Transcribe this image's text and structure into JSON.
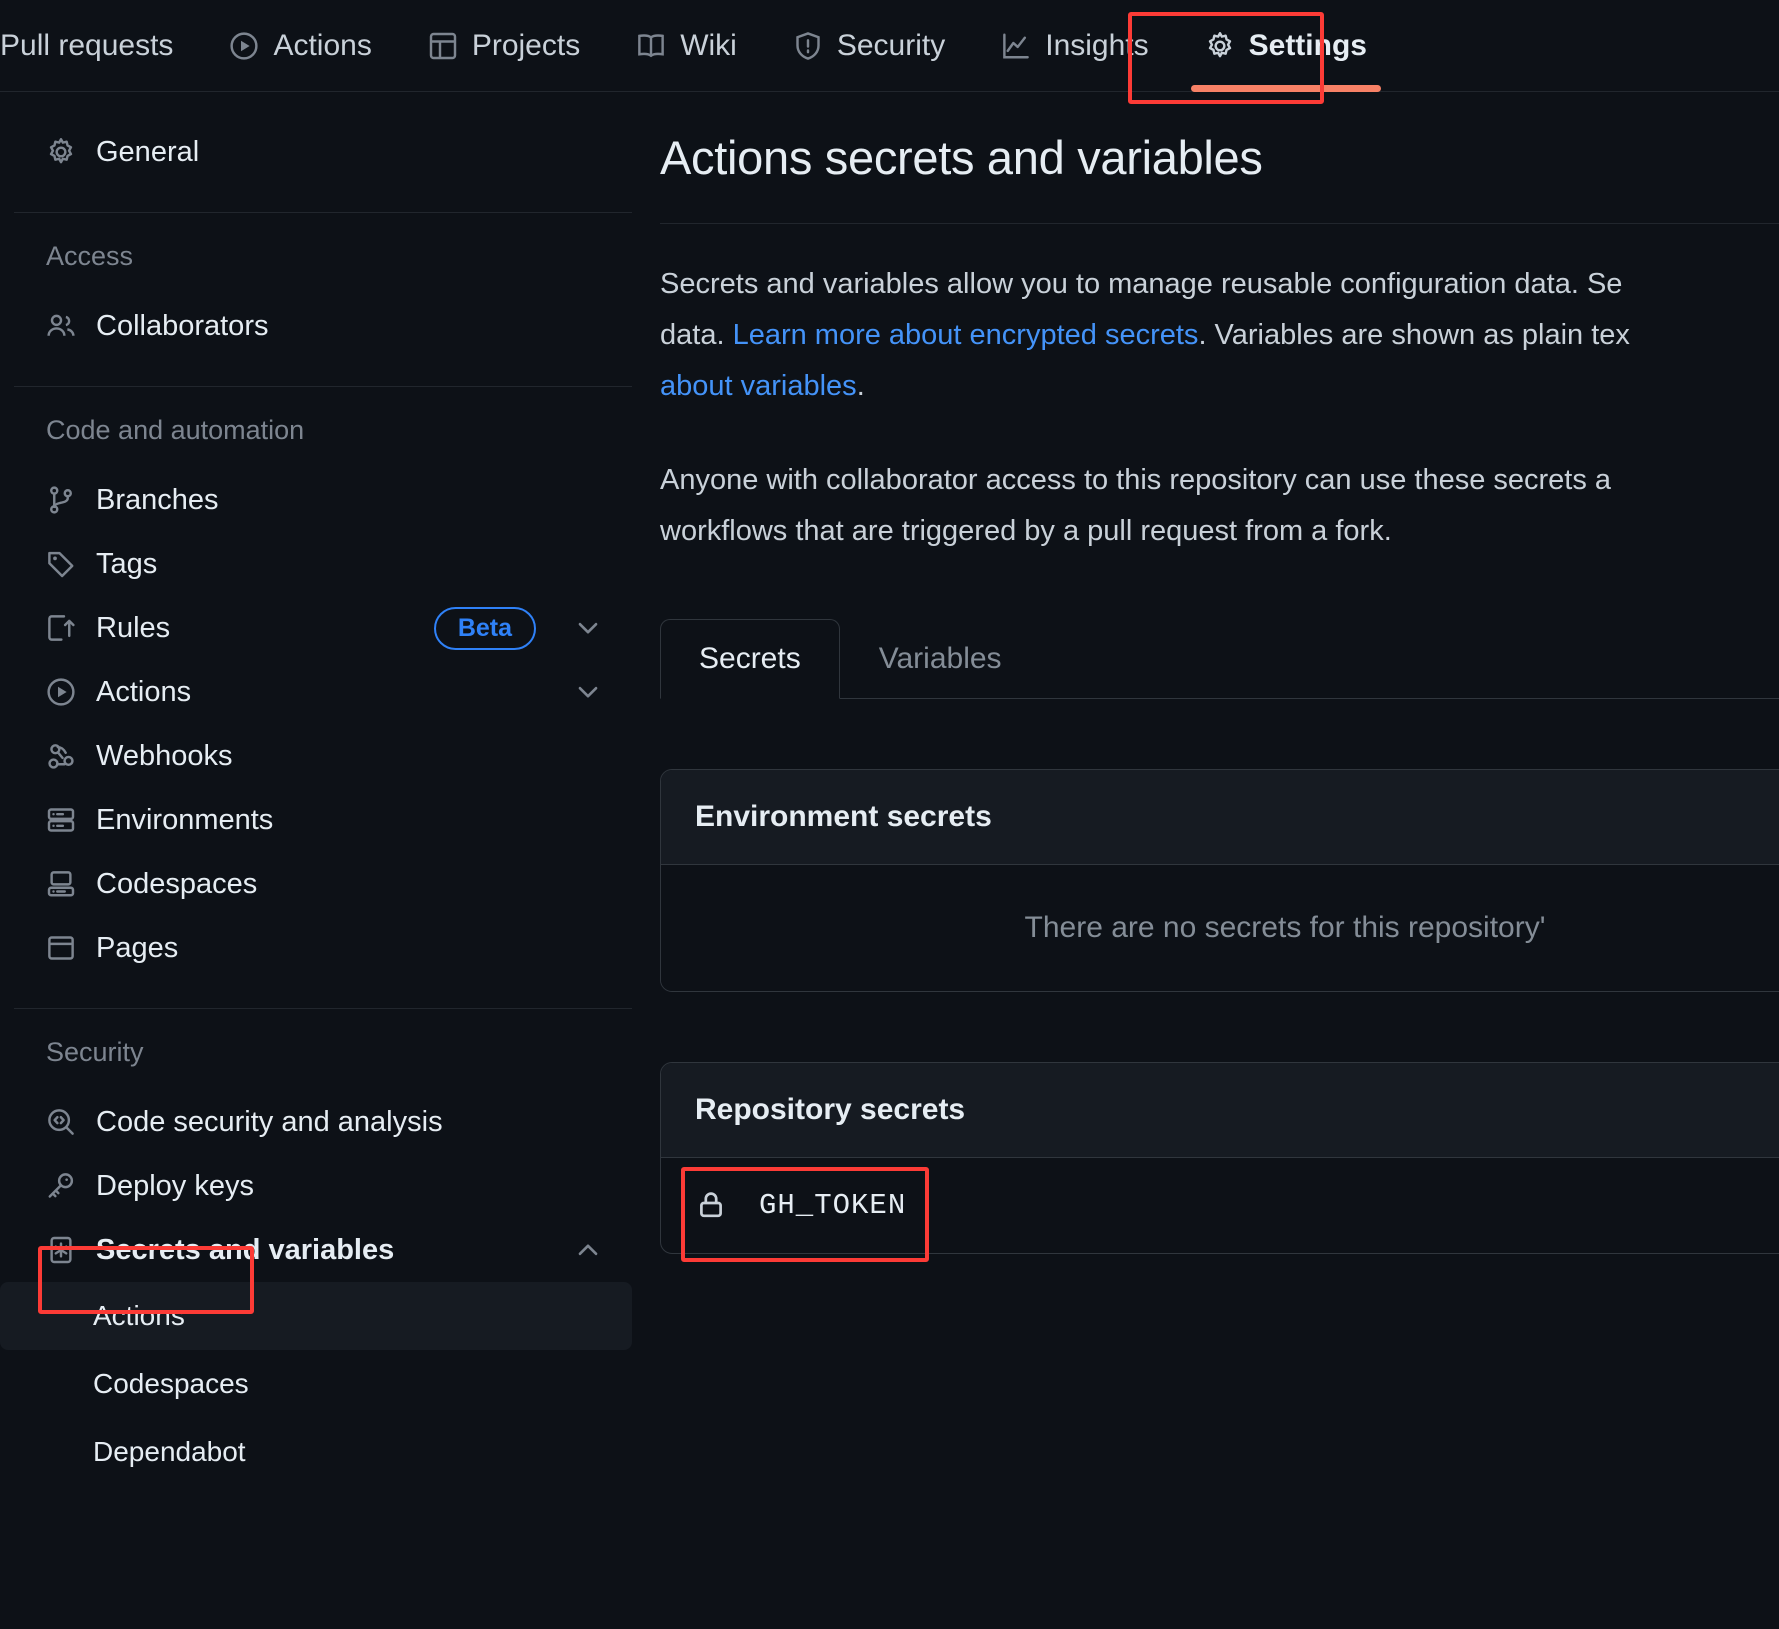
{
  "repo_nav": {
    "items": [
      {
        "label": "Pull requests",
        "icon": "none",
        "active": false
      },
      {
        "label": "Actions",
        "icon": "play-icon",
        "active": false
      },
      {
        "label": "Projects",
        "icon": "table-icon",
        "active": false
      },
      {
        "label": "Wiki",
        "icon": "book-icon",
        "active": false
      },
      {
        "label": "Security",
        "icon": "shield-icon",
        "active": false
      },
      {
        "label": "Insights",
        "icon": "graph-icon",
        "active": false
      },
      {
        "label": "Settings",
        "icon": "gear-icon",
        "active": true
      }
    ]
  },
  "sidebar": {
    "general": {
      "label": "General",
      "icon": "gear-icon"
    },
    "sections": [
      {
        "title": "Access",
        "items": [
          {
            "label": "Collaborators",
            "icon": "people-icon"
          }
        ]
      },
      {
        "title": "Code and automation",
        "items": [
          {
            "label": "Branches",
            "icon": "git-branch-icon"
          },
          {
            "label": "Tags",
            "icon": "tag-icon"
          },
          {
            "label": "Rules",
            "icon": "rules-icon",
            "badge": "Beta",
            "chevron": "chevron-down-icon"
          },
          {
            "label": "Actions",
            "icon": "play-icon",
            "chevron": "chevron-down-icon"
          },
          {
            "label": "Webhooks",
            "icon": "webhook-icon"
          },
          {
            "label": "Environments",
            "icon": "server-icon"
          },
          {
            "label": "Codespaces",
            "icon": "codespaces-icon"
          },
          {
            "label": "Pages",
            "icon": "browser-icon"
          }
        ]
      },
      {
        "title": "Security",
        "items": [
          {
            "label": "Code security and analysis",
            "icon": "codescan-icon"
          },
          {
            "label": "Deploy keys",
            "icon": "key-icon"
          },
          {
            "label": "Secrets and variables",
            "icon": "asterisk-icon",
            "chevron": "chevron-up-icon",
            "bold": true
          }
        ]
      }
    ],
    "secrets_children": [
      {
        "label": "Actions",
        "active": true
      },
      {
        "label": "Codespaces",
        "active": false
      },
      {
        "label": "Dependabot",
        "active": false
      }
    ]
  },
  "main": {
    "title": "Actions secrets and variables",
    "paragraph1": {
      "part1": "Secrets and variables allow you to manage reusable configuration data. Se",
      "part2": "data.",
      "link1": "Learn more about encrypted secrets",
      "part3": ". Variables are shown as plain tex",
      "link2": "about variables",
      "part4": "."
    },
    "paragraph2": {
      "line1": "Anyone with collaborator access to this repository can use these secrets a",
      "line2": "workflows that are triggered by a pull request from a fork."
    },
    "tabs": [
      {
        "label": "Secrets",
        "active": true
      },
      {
        "label": "Variables",
        "active": false
      }
    ],
    "environment_secrets": {
      "header": "Environment secrets",
      "empty_text": "There are no secrets for this repository'"
    },
    "repository_secrets": {
      "header": "Repository secrets",
      "items": [
        {
          "name": "GH_TOKEN",
          "icon": "lock-icon"
        }
      ]
    }
  },
  "colors": {
    "accent_orange": "#f78166",
    "annotation_red": "#fc3b36",
    "link_blue": "#4493f8",
    "beta_blue": "#2f81f7",
    "active_rail": "#4493f8",
    "background": "#0d1117",
    "panel_header": "#161b22"
  }
}
